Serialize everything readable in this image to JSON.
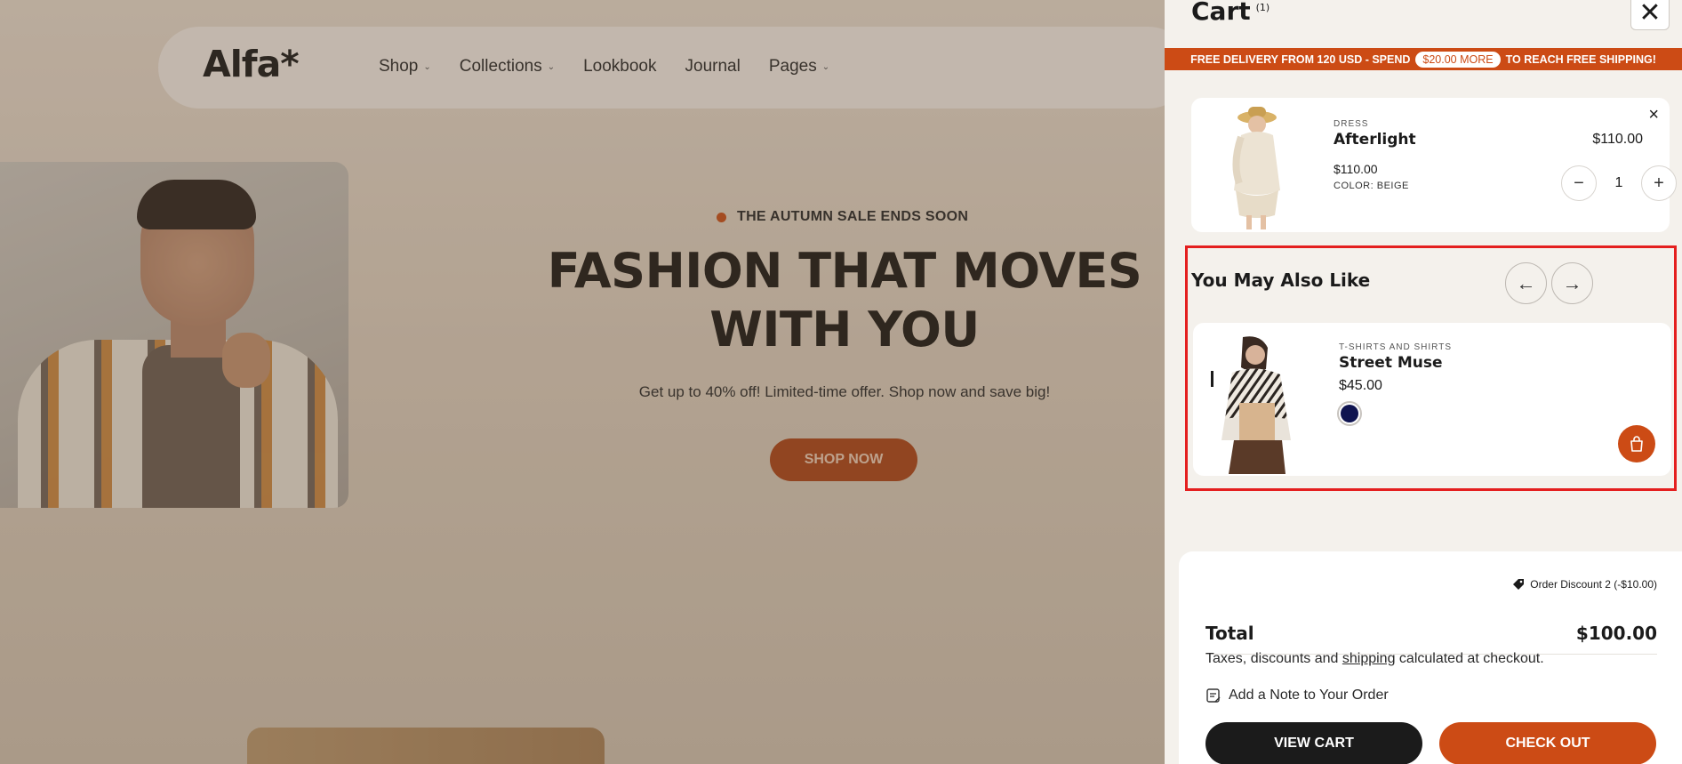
{
  "storefront": {
    "logo": "Alfa*",
    "nav": [
      {
        "label": "Shop",
        "has_dropdown": true
      },
      {
        "label": "Collections",
        "has_dropdown": true
      },
      {
        "label": "Lookbook",
        "has_dropdown": false
      },
      {
        "label": "Journal",
        "has_dropdown": false
      },
      {
        "label": "Pages",
        "has_dropdown": true
      }
    ],
    "sale_tag": "THE AUTUMN SALE ENDS SOON",
    "hero_title_line1": "FASHION THAT MOVES",
    "hero_title_line2": "WITH YOU",
    "hero_subtitle": "Get up to 40% off! Limited-time offer. Shop now and save big!",
    "shop_button": "SHOP NOW"
  },
  "cart": {
    "title": "Cart",
    "count": "(1)",
    "close_icon": "close-icon",
    "shipping_bar": {
      "prefix": "FREE DELIVERY FROM 120 USD - SPEND",
      "amount": "$20.00 MORE",
      "suffix": "TO REACH FREE SHIPPING!"
    },
    "items": [
      {
        "category": "DRESS",
        "name": "Afterlight",
        "price": "$110.00",
        "color": "COLOR: BEIGE",
        "line_total": "$110.00",
        "quantity": "1"
      }
    ],
    "recommendations": {
      "title": "You May Also Like",
      "products": [
        {
          "category": "T-SHIRTS AND SHIRTS",
          "name": "Street Muse",
          "price": "$45.00",
          "swatch_color": "#0f1450"
        }
      ]
    },
    "summary": {
      "discount": "Order Discount 2 (-$10.00)",
      "total_label": "Total",
      "total_value": "$100.00",
      "tax_note_before": "Taxes, discounts and ",
      "tax_note_link": "shipping",
      "tax_note_after": " calculated at checkout.",
      "note_label": "Add a Note to Your Order",
      "view_cart": "VIEW CART",
      "checkout": "CHECK OUT"
    }
  },
  "colors": {
    "accent": "#cc4b15",
    "dark": "#1b1b1b",
    "highlight_border": "#e41f1f"
  }
}
